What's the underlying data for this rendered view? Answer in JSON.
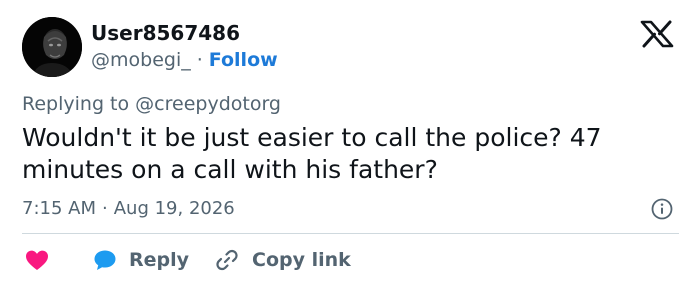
{
  "user": {
    "display_name": "User8567486",
    "handle": "@mobegi_",
    "separator": "·",
    "follow_label": "Follow",
    "avatar_icon": "user-avatar"
  },
  "brand": {
    "logo_icon": "x-logo-icon"
  },
  "reply_context": {
    "prefix": "Replying to",
    "mention": "@creepydotorg"
  },
  "tweet": {
    "text": "Wouldn't it be just easier to call the police? 47 minutes on a call with his father?"
  },
  "meta": {
    "time": "7:15 AM",
    "separator": "·",
    "date": "Aug 19, 2026",
    "info_icon": "info-icon"
  },
  "actions": {
    "like_icon": "heart-icon",
    "reply_icon": "reply-bubble-icon",
    "reply_label": "Reply",
    "copy_icon": "link-icon",
    "copy_label": "Copy link"
  },
  "colors": {
    "accent": "#1d7ad8",
    "heart": "#f91880",
    "reply_bubble": "#1d9bf0",
    "muted_text": "#536471",
    "primary_text": "#0f1419",
    "divider": "#cfd9de"
  }
}
